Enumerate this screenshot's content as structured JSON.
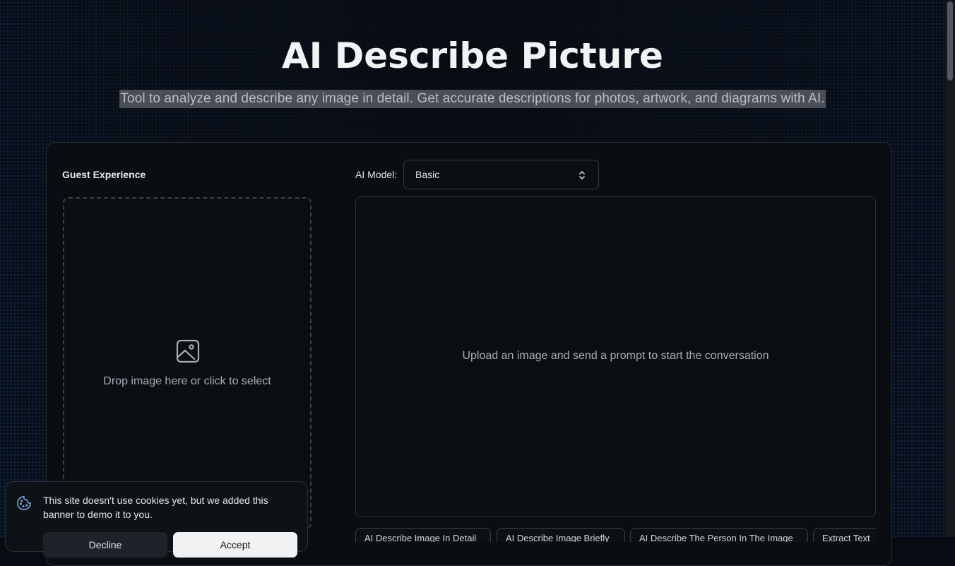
{
  "header": {
    "title": "AI Describe Picture",
    "subtitle": "Tool to analyze and describe any image in detail. Get accurate descriptions for photos, artwork, and diagrams with AI."
  },
  "left_panel": {
    "label": "Guest Experience",
    "dropzone_text": "Drop image here or click to select",
    "dropzone_icon": "image-icon"
  },
  "right_panel": {
    "model_label": "AI Model:",
    "model_selected": "Basic",
    "empty_state": "Upload an image and send a prompt to start the conversation"
  },
  "prompt_chips": [
    "AI Describe Image In Detail",
    "AI Describe Image Briefly",
    "AI Describe The Person In The Image",
    "Extract Text"
  ],
  "cookie_banner": {
    "icon": "cookie-icon",
    "text": "This site doesn't use cookies yet, but we added this banner to demo it to you.",
    "decline_label": "Decline",
    "accept_label": "Accept"
  },
  "colors": {
    "background": "#080c12",
    "panel": "#0b0e13",
    "border": "#2e333b",
    "text_muted": "#a9aeb6",
    "highlight": "#4a4f57"
  }
}
